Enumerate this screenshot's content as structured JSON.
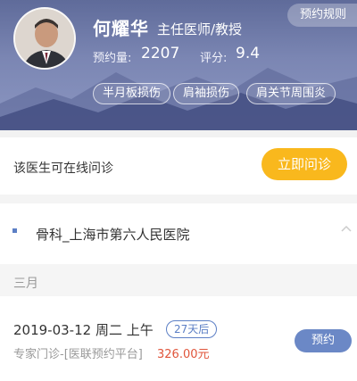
{
  "header": {
    "rules_button": "预约规则",
    "doctor": {
      "name": "何耀华",
      "title": "主任医师/教授",
      "appointments_label": "预约量:",
      "appointments_value": "2207",
      "rating_label": "评分:",
      "rating_value": "9.4"
    },
    "tags": [
      "半月板损伤",
      "肩袖损伤",
      "肩关节周围炎"
    ]
  },
  "online": {
    "text": "该医生可在线问诊",
    "button": "立即问诊"
  },
  "department": {
    "label": "骨科_上海市第六人民医院"
  },
  "schedule": {
    "month": "三月",
    "slots": [
      {
        "date": "2019-03-12 周二 上午",
        "badge": "27天后",
        "type": "专家门诊-[医联预约平台]",
        "price": "326.00元",
        "button": "预约"
      }
    ]
  },
  "colors": {
    "header_bg": "#6f7aa8",
    "accent_yellow": "#f9b81d",
    "accent_blue": "#5c7fc5",
    "price_red": "#e0553b"
  }
}
